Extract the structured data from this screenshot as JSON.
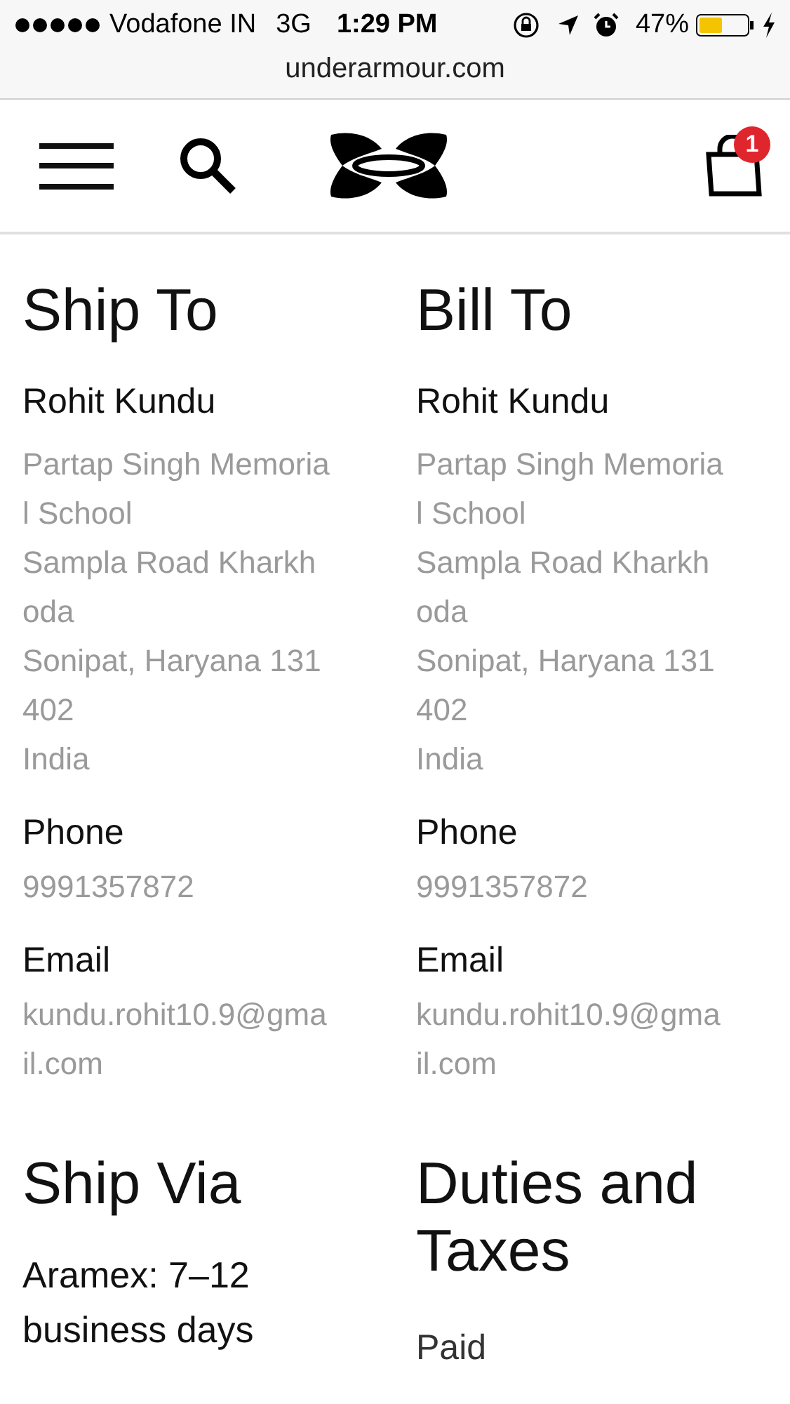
{
  "status_bar": {
    "carrier": "Vodafone IN",
    "network": "3G",
    "time": "1:29 PM",
    "battery": "47%"
  },
  "url": "underarmour.com",
  "header": {
    "cart_count": "1"
  },
  "addresses": [
    {
      "title": "Ship To",
      "name": "Rohit Kundu",
      "address_lines": [
        "Partap Singh Memoria",
        "l School",
        "Sampla Road Kharkh",
        "oda",
        "Sonipat, Haryana 131",
        "402",
        "India"
      ],
      "phone_label": "Phone",
      "phone": "9991357872",
      "email_label": "Email",
      "email_lines": [
        "kundu.rohit10.9@gma",
        "il.com"
      ]
    },
    {
      "title": "Bill To",
      "name": "Rohit Kundu",
      "address_lines": [
        "Partap Singh Memoria",
        "l School",
        "Sampla Road Kharkh",
        "oda",
        "Sonipat, Haryana 131",
        "402",
        "India"
      ],
      "phone_label": "Phone",
      "phone": "9991357872",
      "email_label": "Email",
      "email_lines": [
        "kundu.rohit10.9@gma",
        "il.com"
      ]
    }
  ],
  "ship_via": {
    "title": "Ship Via",
    "lines": [
      "Aramex: 7–12",
      "business days"
    ]
  },
  "duties": {
    "title_lines": [
      "Duties and",
      "Taxes"
    ],
    "status": "Paid"
  }
}
